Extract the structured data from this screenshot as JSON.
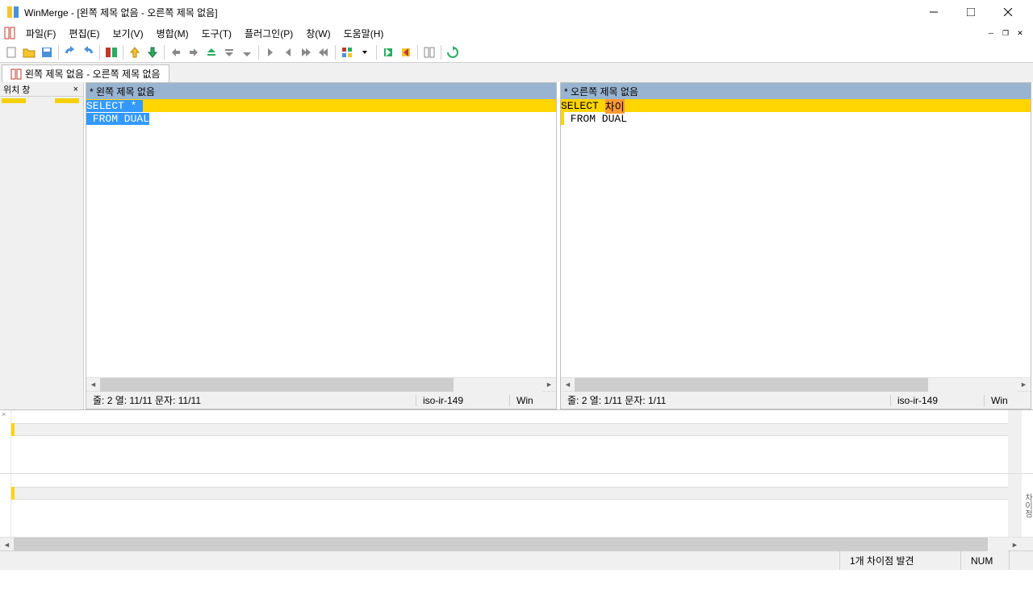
{
  "titlebar": {
    "title": "WinMerge - [왼쪽 제목 없음 - 오른쪽 제목 없음]"
  },
  "menubar": {
    "items": [
      "파일(F)",
      "편집(E)",
      "보기(V)",
      "병합(M)",
      "도구(T)",
      "플러그인(P)",
      "창(W)",
      "도움말(H)"
    ]
  },
  "tab": {
    "label": "왼쪽 제목 없음 - 오른쪽 제목 없음"
  },
  "location_pane": {
    "title": "위치 창"
  },
  "left_pane": {
    "header": "* 왼쪽 제목 없음",
    "line1": "SELECT * ",
    "line2": " FROM DUAL",
    "status": "줄: 2  열: 11/11  문자: 11/11",
    "encoding": "iso-ir-149",
    "eol": "Win"
  },
  "right_pane": {
    "header": "* 오른쪽 제목 없음",
    "line1_a": "SELECT ",
    "line1_b": "차이",
    "line2": " FROM DUAL",
    "status": "줄: 2  열: 1/11  문자: 1/11",
    "encoding": "iso-ir-149",
    "eol": "Win"
  },
  "bottom_vlabel": "차이점",
  "statusbar": {
    "diff_count": "1개 차이점 발견",
    "num": "NUM"
  }
}
